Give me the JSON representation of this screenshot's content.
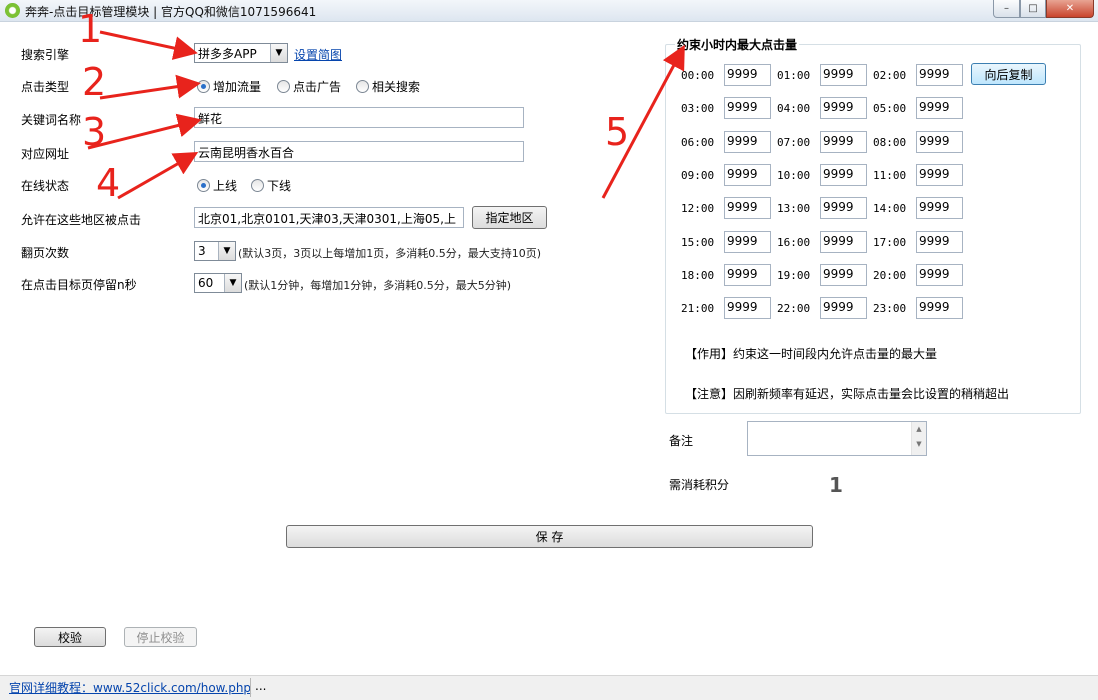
{
  "window": {
    "title": "奔奔-点击目标管理模块 | 官方QQ和微信1071596641",
    "minimize_glyph": "–",
    "maximize_glyph": "□",
    "close_glyph": "✕"
  },
  "form": {
    "search_engine": {
      "label": "搜索引擎",
      "value": "拼多多APP",
      "link": "设置简图"
    },
    "click_type": {
      "label": "点击类型",
      "options": [
        "增加流量",
        "点击广告",
        "相关搜索"
      ],
      "selected": "增加流量"
    },
    "keyword": {
      "label": "关键词名称",
      "value": "鲜花"
    },
    "url": {
      "label": "对应网址",
      "value": "云南昆明香水百合"
    },
    "online_status": {
      "label": "在线状态",
      "options": [
        "上线",
        "下线"
      ],
      "selected": "上线"
    },
    "regions": {
      "label": "允许在这些地区被点击",
      "value": "北京01,北京0101,天津03,天津0301,上海05,上",
      "button": "指定地区"
    },
    "pages": {
      "label": "翻页次数",
      "value": "3",
      "note": "(默认3页，3页以上每增加1页，多消耗0.5分，最大支持10页)"
    },
    "stay": {
      "label": "在点击目标页停留n秒",
      "value": "60",
      "note": "(默认1分钟，每增加1分钟，多消耗0.5分，最大5分钟)"
    }
  },
  "hourly": {
    "title": "约束小时内最大点击量",
    "copy_button": "向后复制",
    "slots": [
      {
        "time": "00:00",
        "value": "9999"
      },
      {
        "time": "01:00",
        "value": "9999"
      },
      {
        "time": "02:00",
        "value": "9999"
      },
      {
        "time": "03:00",
        "value": "9999"
      },
      {
        "time": "04:00",
        "value": "9999"
      },
      {
        "time": "05:00",
        "value": "9999"
      },
      {
        "time": "06:00",
        "value": "9999"
      },
      {
        "time": "07:00",
        "value": "9999"
      },
      {
        "time": "08:00",
        "value": "9999"
      },
      {
        "time": "09:00",
        "value": "9999"
      },
      {
        "time": "10:00",
        "value": "9999"
      },
      {
        "time": "11:00",
        "value": "9999"
      },
      {
        "time": "12:00",
        "value": "9999"
      },
      {
        "time": "13:00",
        "value": "9999"
      },
      {
        "time": "14:00",
        "value": "9999"
      },
      {
        "time": "15:00",
        "value": "9999"
      },
      {
        "time": "16:00",
        "value": "9999"
      },
      {
        "time": "17:00",
        "value": "9999"
      },
      {
        "time": "18:00",
        "value": "9999"
      },
      {
        "time": "19:00",
        "value": "9999"
      },
      {
        "time": "20:00",
        "value": "9999"
      },
      {
        "time": "21:00",
        "value": "9999"
      },
      {
        "time": "22:00",
        "value": "9999"
      },
      {
        "time": "23:00",
        "value": "9999"
      }
    ],
    "note_effect": "【作用】约束这一时间段内允许点击量的最大量",
    "note_warning": "【注意】因刷新频率有延迟，实际点击量会比设置的稍稍超出"
  },
  "remark": {
    "label": "备注",
    "value": ""
  },
  "cost": {
    "label": "需消耗积分",
    "value": "1"
  },
  "save_button": "保 存",
  "verify_button": "校验",
  "stop_verify_button": "停止校验",
  "status": {
    "link": "官网详细教程：www.52click.com/how.php",
    "extra": "..."
  },
  "annotations": [
    "1",
    "2",
    "3",
    "4",
    "5"
  ],
  "colors": {
    "annotation": "#e8231c",
    "link": "#0645ad",
    "radio_selected": "#2a6fc9"
  }
}
